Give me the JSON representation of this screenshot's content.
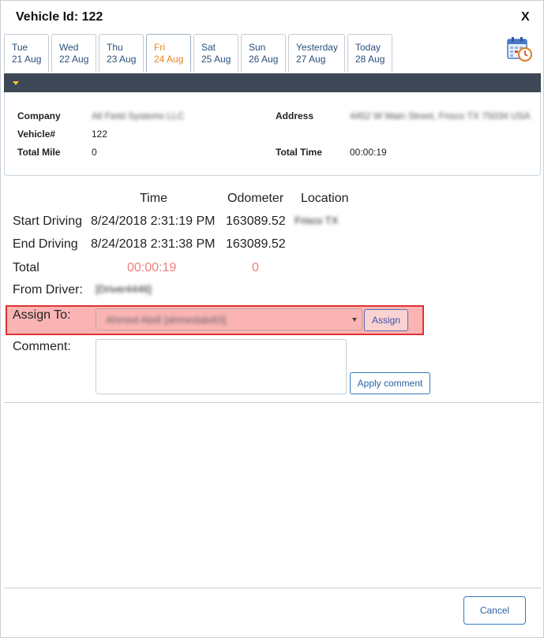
{
  "dialog": {
    "title": "Vehicle Id: 122",
    "close_label": "X"
  },
  "tabs": [
    {
      "day": "Tue",
      "date": "21 Aug"
    },
    {
      "day": "Wed",
      "date": "22 Aug"
    },
    {
      "day": "Thu",
      "date": "23 Aug"
    },
    {
      "day": "Fri",
      "date": "24 Aug",
      "active": true
    },
    {
      "day": "Sat",
      "date": "25 Aug"
    },
    {
      "day": "Sun",
      "date": "26 Aug"
    },
    {
      "day": "Yesterday",
      "date": "27 Aug"
    },
    {
      "day": "Today",
      "date": "28 Aug"
    }
  ],
  "calendar_icon": "calendar-clock-icon",
  "info": {
    "company_label": "Company",
    "company_value": "All Field Systems LLC",
    "vehicle_label": "Vehicle#",
    "vehicle_value": "122",
    "total_mile_label": "Total Mile",
    "total_mile_value": "0",
    "address_label": "Address",
    "address_value": "4452 W Main Street, Frisco TX 75034 USA",
    "total_time_label": "Total Time",
    "total_time_value": "00:00:19"
  },
  "table": {
    "headers": {
      "time": "Time",
      "odometer": "Odometer",
      "location": "Location"
    },
    "start": {
      "label": "Start Driving",
      "time": "8/24/2018 2:31:19 PM",
      "odometer": "163089.52",
      "location": "Frisco TX"
    },
    "end": {
      "label": "End Driving",
      "time": "8/24/2018 2:31:38 PM",
      "odometer": "163089.52"
    },
    "total": {
      "label": "Total",
      "time": "00:00:19",
      "odometer": "0"
    },
    "from_driver": {
      "label": "From Driver:",
      "value": "[Driver4446]"
    }
  },
  "assign": {
    "label": "Assign To:",
    "selected": "Ahmed Abdi [ahmedabdi3]",
    "button": "Assign"
  },
  "comment": {
    "label": "Comment:",
    "value": "",
    "button": "Apply comment"
  },
  "footer": {
    "cancel_label": "Cancel"
  },
  "colors": {
    "accent_orange": "#e8811a",
    "header_bar": "#3d4756",
    "highlight": "#fbb4b4",
    "highlight_border": "#dd3333",
    "link_blue": "#2b63a6"
  }
}
